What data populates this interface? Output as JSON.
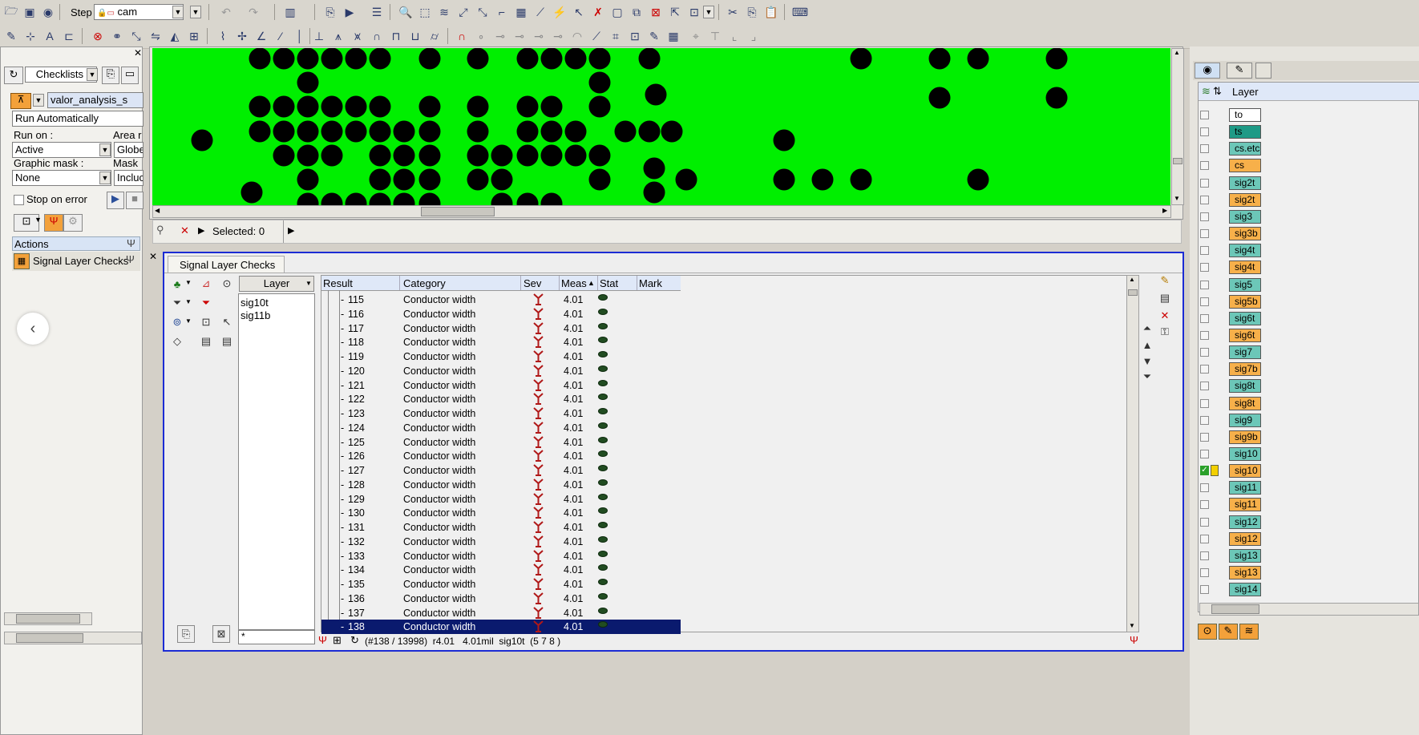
{
  "toolbar": {
    "step_label": "Step",
    "step_value": "cam"
  },
  "left_panel": {
    "checklists_label": "Checklists",
    "analysis_name": "valor_analysis_s",
    "run_mode": "Run Automatically",
    "run_on_label": "Run on :",
    "run_on_value": "Active",
    "area_label": "Area r",
    "area_value": "Globe",
    "graphic_mask_label": "Graphic mask :",
    "graphic_mask_value": "None",
    "mask_label": "Mask",
    "mask_value": "Incluc",
    "stop_on_error_label": "Stop on error",
    "actions_label": "Actions",
    "action_item": "Signal Layer Checks"
  },
  "graphics_status": {
    "selected_label": "Selected: 0"
  },
  "results_panel": {
    "tab_label": "Signal Layer Checks",
    "layer_header": "Layer",
    "layers": [
      "sig10t",
      "sig11b"
    ],
    "layer_filter": "*",
    "columns": {
      "result": "Result",
      "category": "Category",
      "sev": "Sev",
      "meas": "Meas",
      "stat": "Stat",
      "mark": "Mark"
    },
    "rows": [
      {
        "id": "115",
        "category": "Conductor width",
        "meas": "4.01"
      },
      {
        "id": "116",
        "category": "Conductor width",
        "meas": "4.01"
      },
      {
        "id": "117",
        "category": "Conductor width",
        "meas": "4.01"
      },
      {
        "id": "118",
        "category": "Conductor width",
        "meas": "4.01"
      },
      {
        "id": "119",
        "category": "Conductor width",
        "meas": "4.01"
      },
      {
        "id": "120",
        "category": "Conductor width",
        "meas": "4.01"
      },
      {
        "id": "121",
        "category": "Conductor width",
        "meas": "4.01"
      },
      {
        "id": "122",
        "category": "Conductor width",
        "meas": "4.01"
      },
      {
        "id": "123",
        "category": "Conductor width",
        "meas": "4.01"
      },
      {
        "id": "124",
        "category": "Conductor width",
        "meas": "4.01"
      },
      {
        "id": "125",
        "category": "Conductor width",
        "meas": "4.01"
      },
      {
        "id": "126",
        "category": "Conductor width",
        "meas": "4.01"
      },
      {
        "id": "127",
        "category": "Conductor width",
        "meas": "4.01"
      },
      {
        "id": "128",
        "category": "Conductor width",
        "meas": "4.01"
      },
      {
        "id": "129",
        "category": "Conductor width",
        "meas": "4.01"
      },
      {
        "id": "130",
        "category": "Conductor width",
        "meas": "4.01"
      },
      {
        "id": "131",
        "category": "Conductor width",
        "meas": "4.01"
      },
      {
        "id": "132",
        "category": "Conductor width",
        "meas": "4.01"
      },
      {
        "id": "133",
        "category": "Conductor width",
        "meas": "4.01"
      },
      {
        "id": "134",
        "category": "Conductor width",
        "meas": "4.01"
      },
      {
        "id": "135",
        "category": "Conductor width",
        "meas": "4.01"
      },
      {
        "id": "136",
        "category": "Conductor width",
        "meas": "4.01"
      },
      {
        "id": "137",
        "category": "Conductor width",
        "meas": "4.01"
      },
      {
        "id": "138",
        "category": "Conductor width",
        "meas": "4.01",
        "selected": true
      }
    ],
    "status_text": "(#138 / 13998)  r4.01   4.01mil  sig10t  (5 7 8 )"
  },
  "layers_panel": {
    "header": "Layer",
    "items": [
      {
        "name": "to",
        "style": "white"
      },
      {
        "name": "ts",
        "style": "dark"
      },
      {
        "name": "cs.etc",
        "style": "teal"
      },
      {
        "name": "cs",
        "style": "orange"
      },
      {
        "name": "sig2t",
        "style": "teal"
      },
      {
        "name": "sig2t",
        "style": "orange"
      },
      {
        "name": "sig3",
        "style": "teal"
      },
      {
        "name": "sig3b",
        "style": "orange"
      },
      {
        "name": "sig4t",
        "style": "teal"
      },
      {
        "name": "sig4t",
        "style": "orange"
      },
      {
        "name": "sig5",
        "style": "teal"
      },
      {
        "name": "sig5b",
        "style": "orange"
      },
      {
        "name": "sig6t",
        "style": "teal"
      },
      {
        "name": "sig6t",
        "style": "orange"
      },
      {
        "name": "sig7",
        "style": "teal"
      },
      {
        "name": "sig7b",
        "style": "orange"
      },
      {
        "name": "sig8t",
        "style": "teal"
      },
      {
        "name": "sig8t",
        "style": "orange"
      },
      {
        "name": "sig9",
        "style": "teal"
      },
      {
        "name": "sig9b",
        "style": "orange"
      },
      {
        "name": "sig10",
        "style": "teal"
      },
      {
        "name": "sig10",
        "style": "orange"
      },
      {
        "name": "sig11",
        "style": "teal"
      },
      {
        "name": "sig11",
        "style": "orange"
      },
      {
        "name": "sig12",
        "style": "teal"
      },
      {
        "name": "sig12",
        "style": "orange"
      },
      {
        "name": "sig13",
        "style": "teal"
      },
      {
        "name": "sig13",
        "style": "orange"
      },
      {
        "name": "sig14",
        "style": "teal"
      }
    ]
  },
  "colors": {
    "canvas_bg": "#00ef00",
    "pad": "#000000",
    "selection": "#0a1a6e",
    "layer_orange": "#f7b04a",
    "layer_teal": "#6cc7b8"
  }
}
